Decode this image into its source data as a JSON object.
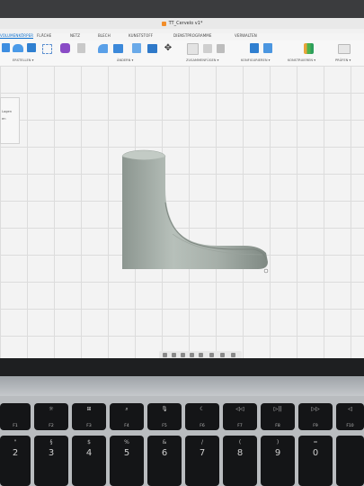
{
  "window": {
    "title": "TT_Cervelo v1*"
  },
  "ribbon": {
    "tabs": [
      "VOLUMENKÖRPER",
      "FLÄCHE",
      "NETZ",
      "BLECH",
      "KUNSTSTOFF",
      "DIENSTPROGRAMME",
      "VERWALTEN"
    ],
    "groups": [
      "ERSTELLEN ▾",
      "ÄNDERN ▾",
      "ZUSAMMENFÜGEN ▾",
      "KONFIGURIEREN ▾",
      "KONSTRUIEREN ▾",
      "PRÜFEN ▾"
    ],
    "accent": "#0a6fcf"
  },
  "browser": {
    "items": [
      "Lagen",
      "en"
    ]
  },
  "keyboard": {
    "fn_row": [
      {
        "icon": "",
        "label": "F1"
      },
      {
        "icon": "☼",
        "label": "F2"
      },
      {
        "icon": "⊞",
        "label": "F3"
      },
      {
        "icon": "⌕",
        "label": "F4"
      },
      {
        "icon": "🎙",
        "label": "F5"
      },
      {
        "icon": "☾",
        "label": "F6"
      },
      {
        "icon": "◁◁",
        "label": "F7"
      },
      {
        "icon": "▷||",
        "label": "F8"
      },
      {
        "icon": "▷▷",
        "label": "F9"
      },
      {
        "icon": "◁",
        "label": "F10"
      }
    ],
    "num_row": [
      {
        "top": "\"",
        "main": "2"
      },
      {
        "top": "§",
        "main": "3"
      },
      {
        "top": "$",
        "main": "4"
      },
      {
        "top": "%",
        "main": "5"
      },
      {
        "top": "&",
        "main": "6"
      },
      {
        "top": "/",
        "main": "7"
      },
      {
        "top": "(",
        "main": "8"
      },
      {
        "top": ")",
        "main": "9"
      },
      {
        "top": "=",
        "main": "0"
      }
    ]
  }
}
